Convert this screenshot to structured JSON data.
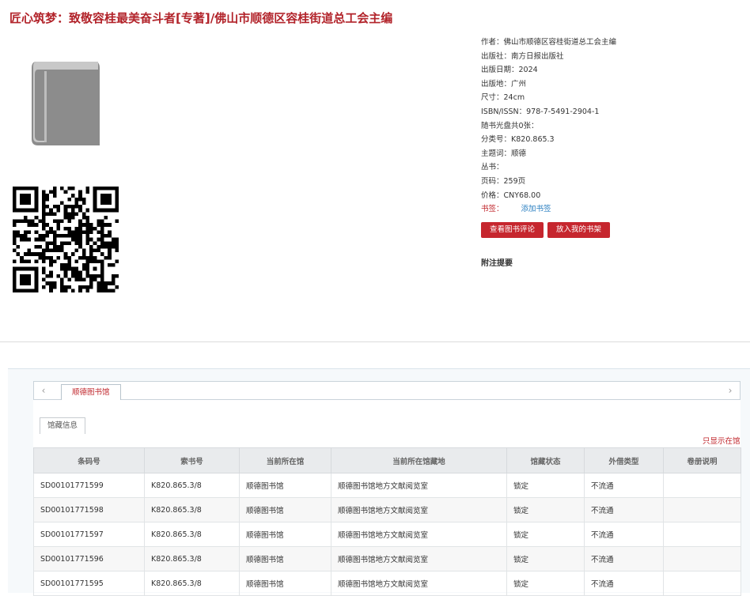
{
  "book": {
    "title": "匠心筑梦：致敬容桂最美奋斗者[专著]/佛山市顺德区容桂街道总工会主编"
  },
  "meta": {
    "rows": [
      {
        "label": "作者：",
        "value": "佛山市顺德区容桂街道总工会主编"
      },
      {
        "label": "出版社：",
        "value": "南方日报出版社"
      },
      {
        "label": "出版日期：",
        "value": "2024"
      },
      {
        "label": "出版地：",
        "value": "广州"
      },
      {
        "label": "尺寸：",
        "value": "24cm"
      },
      {
        "label": "ISBN/ISSN：",
        "value": "978-7-5491-2904-1"
      },
      {
        "label": "随书光盘共0张：",
        "value": ""
      },
      {
        "label": "分类号：",
        "value": "K820.865.3"
      },
      {
        "label": "主题词：",
        "value": "顺德"
      },
      {
        "label": "丛书：",
        "value": ""
      },
      {
        "label": "页码：",
        "value": "259页"
      },
      {
        "label": "价格：",
        "value": "CNY68.00"
      }
    ],
    "tags_label": "书签：",
    "add_tag": "添加书签"
  },
  "actions": {
    "view_reviews": "查看图书评论",
    "add_shelf": "放入我的书架"
  },
  "note_heading": "附注提要",
  "holdings": {
    "tab_label": "顺德图书馆",
    "subtab_label": "馆藏信息",
    "only_show": "只显示在馆",
    "columns": [
      "条码号",
      "索书号",
      "当前所在馆",
      "当前所在馆藏地",
      "馆藏状态",
      "外借类型",
      "卷册说明"
    ],
    "rows": [
      [
        "SD00101771599",
        "K820.865.3/8",
        "顺德图书馆",
        "顺德图书馆地方文献阅览室",
        "锁定",
        "不流通",
        ""
      ],
      [
        "SD00101771598",
        "K820.865.3/8",
        "顺德图书馆",
        "顺德图书馆地方文献阅览室",
        "锁定",
        "不流通",
        ""
      ],
      [
        "SD00101771597",
        "K820.865.3/8",
        "顺德图书馆",
        "顺德图书馆地方文献阅览室",
        "锁定",
        "不流通",
        ""
      ],
      [
        "SD00101771596",
        "K820.865.3/8",
        "顺德图书馆",
        "顺德图书馆地方文献阅览室",
        "锁定",
        "不流通",
        ""
      ],
      [
        "SD00101771595",
        "K820.865.3/8",
        "顺德图书馆",
        "顺德图书馆地方文献阅览室",
        "锁定",
        "不流通",
        ""
      ]
    ]
  },
  "colors": {
    "accent": "#b2232a",
    "button": "#c6262e",
    "link": "#2a7fc1"
  }
}
